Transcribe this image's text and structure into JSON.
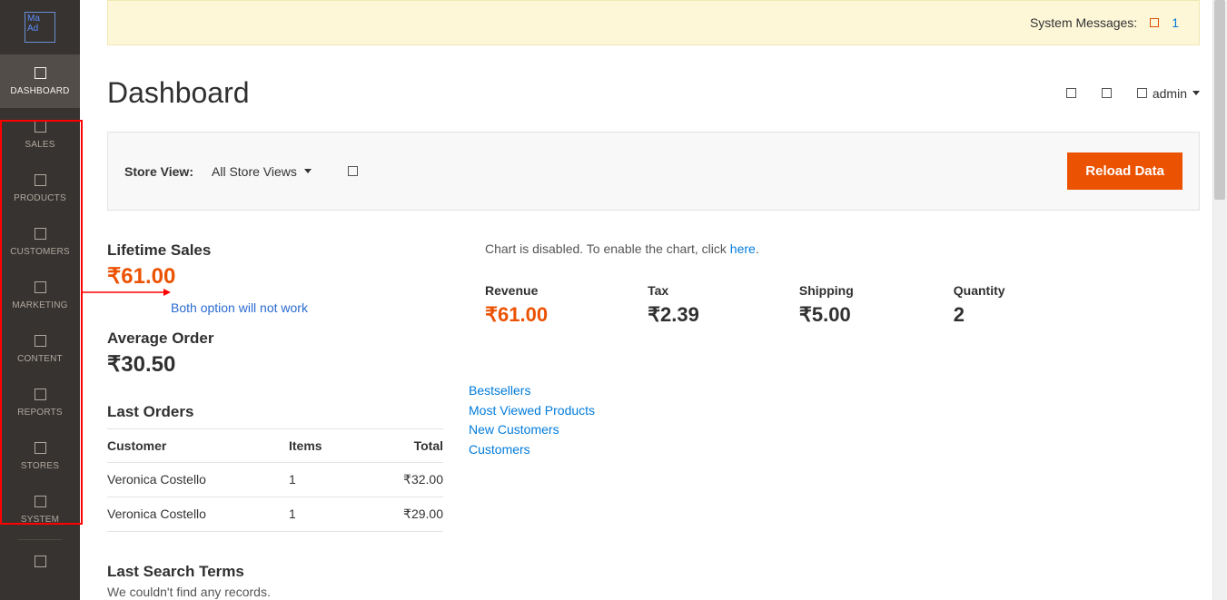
{
  "sidebar": {
    "logo_alt": "Ma Ad",
    "items": [
      {
        "label": "DASHBOARD",
        "active": true
      },
      {
        "label": "SALES"
      },
      {
        "label": "PRODUCTS"
      },
      {
        "label": "CUSTOMERS"
      },
      {
        "label": "MARKETING"
      },
      {
        "label": "CONTENT"
      },
      {
        "label": "REPORTS"
      },
      {
        "label": "STORES"
      },
      {
        "label": "SYSTEM"
      },
      {
        "label": ""
      }
    ]
  },
  "system_messages": {
    "label": "System Messages:",
    "count": "1"
  },
  "page_title": "Dashboard",
  "admin_user": "admin",
  "store_view": {
    "label": "Store View:",
    "value": "All Store Views"
  },
  "reload_button": "Reload Data",
  "lifetime_sales": {
    "label": "Lifetime Sales",
    "value": "₹61.00"
  },
  "annotation_text": "Both option will not work",
  "average_order": {
    "label": "Average Order",
    "value": "₹30.50"
  },
  "last_orders": {
    "label": "Last Orders",
    "columns": {
      "customer": "Customer",
      "items": "Items",
      "total": "Total"
    },
    "rows": [
      {
        "customer": "Veronica Costello",
        "items": "1",
        "total": "₹32.00"
      },
      {
        "customer": "Veronica Costello",
        "items": "1",
        "total": "₹29.00"
      }
    ]
  },
  "last_search": {
    "label": "Last Search Terms",
    "empty": "We couldn't find any records."
  },
  "chart_note": {
    "prefix": "Chart is disabled. To enable the chart, click ",
    "link": "here",
    "suffix": "."
  },
  "metrics": {
    "revenue": {
      "label": "Revenue",
      "value": "₹61.00"
    },
    "tax": {
      "label": "Tax",
      "value": "₹2.39"
    },
    "shipping": {
      "label": "Shipping",
      "value": "₹5.00"
    },
    "quantity": {
      "label": "Quantity",
      "value": "2"
    }
  },
  "tabs": [
    "Bestsellers",
    "Most Viewed Products",
    "New Customers",
    "Customers"
  ]
}
